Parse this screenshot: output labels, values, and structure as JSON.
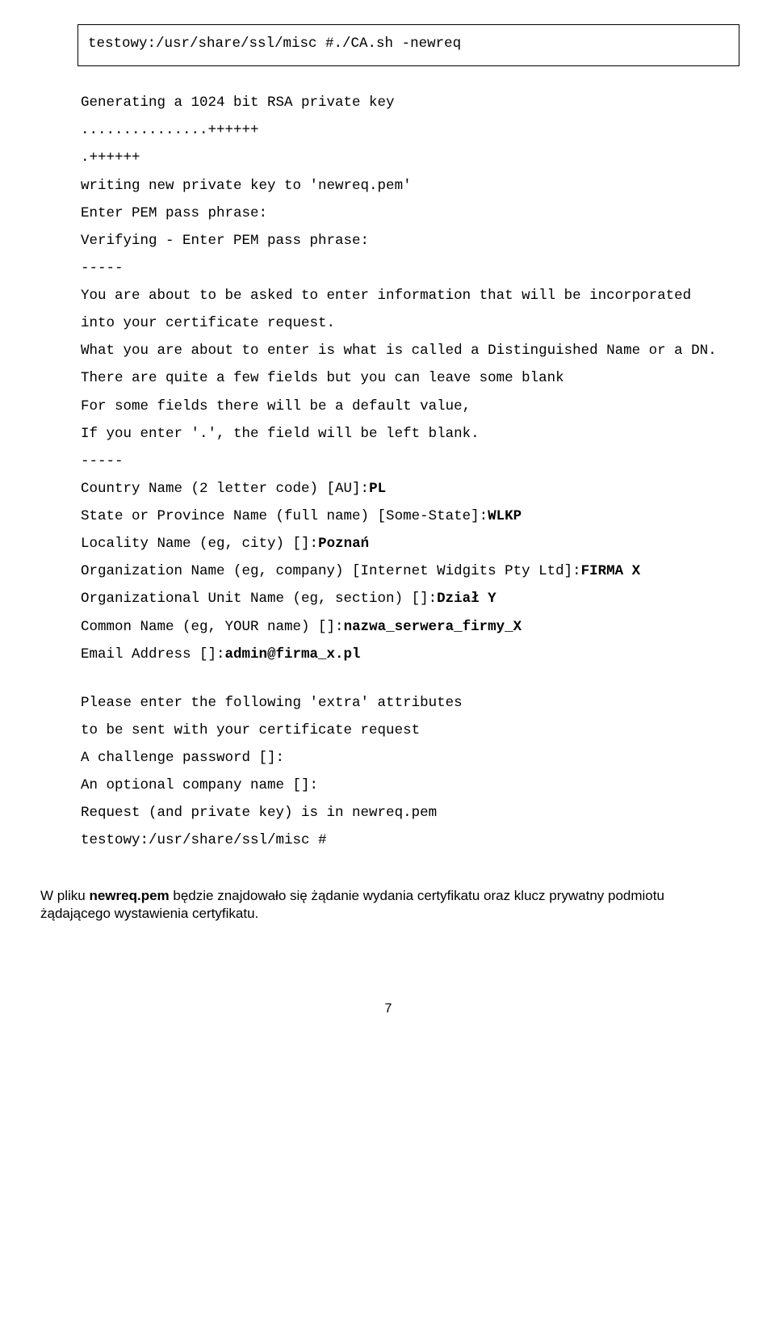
{
  "cmd": "testowy:/usr/share/ssl/misc #./CA.sh -newreq",
  "lines": {
    "l1": "Generating a 1024 bit RSA private key",
    "l2": "...............++++++",
    "l3": ".++++++",
    "l4": "writing new private key to 'newreq.pem'",
    "l5": "Enter PEM pass phrase:",
    "l6": "Verifying - Enter PEM pass phrase:",
    "l7": "-----",
    "l8": "You are about to be asked to enter information that will be incorporated",
    "l9": "into your certificate request.",
    "l10": "What you are about to enter is what is called a Distinguished Name or a DN.",
    "l11": "There are quite a few fields but you can leave some blank",
    "l12": "For some fields there will be a default value,",
    "l13": "If you enter '.', the field will be left blank.",
    "l14": "-----",
    "p1a": "Country Name (2 letter code) [AU]:",
    "p1b": "PL",
    "p2a": "State or Province Name (full name) [Some-State]:",
    "p2b": "WLKP",
    "p3a": "Locality Name (eg, city) []:",
    "p3b": "Poznań",
    "p4a": "Organization Name (eg, company) [Internet Widgits Pty Ltd]:",
    "p4b": "FIRMA X",
    "p5a": "Organizational Unit Name (eg, section) []:",
    "p5b": "Dział Y",
    "p6a": "Common Name (eg, YOUR name) []:",
    "p6b": "nazwa_serwera_firmy_X",
    "p7a": "Email Address []:",
    "p7b": "admin@firma_x.pl",
    "e1": "Please enter the following 'extra' attributes",
    "e2": "to be sent with your certificate request",
    "e3": "A challenge password []:",
    "e4": "An optional company name []:",
    "e5": "Request (and private key) is in newreq.pem",
    "e6": "testowy:/usr/share/ssl/misc #"
  },
  "para": {
    "a": "W pliku ",
    "b": "newreq.pem",
    "c": " będzie znajdowało się żądanie wydania certyfikatu oraz klucz prywatny podmiotu żądającego wystawienia certyfikatu."
  },
  "pagenum": "7"
}
